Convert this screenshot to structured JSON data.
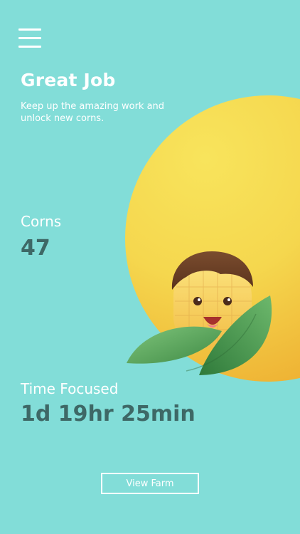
{
  "header": {
    "title": "Great Job",
    "subtitle": "Keep up the amazing work and unlock new corns."
  },
  "stats": {
    "corns": {
      "label": "Corns",
      "value": "47"
    },
    "time_focused": {
      "label": "Time Focused",
      "value": "1d 19hr 25min"
    }
  },
  "actions": {
    "view_farm_label": "View Farm"
  },
  "icons": {
    "menu": "hamburger-menu-icon",
    "mascot": "corn-mascot-illustration"
  },
  "colors": {
    "background": "#82ddd8",
    "sun": "#f5d74e",
    "value_text": "#3e6866"
  }
}
